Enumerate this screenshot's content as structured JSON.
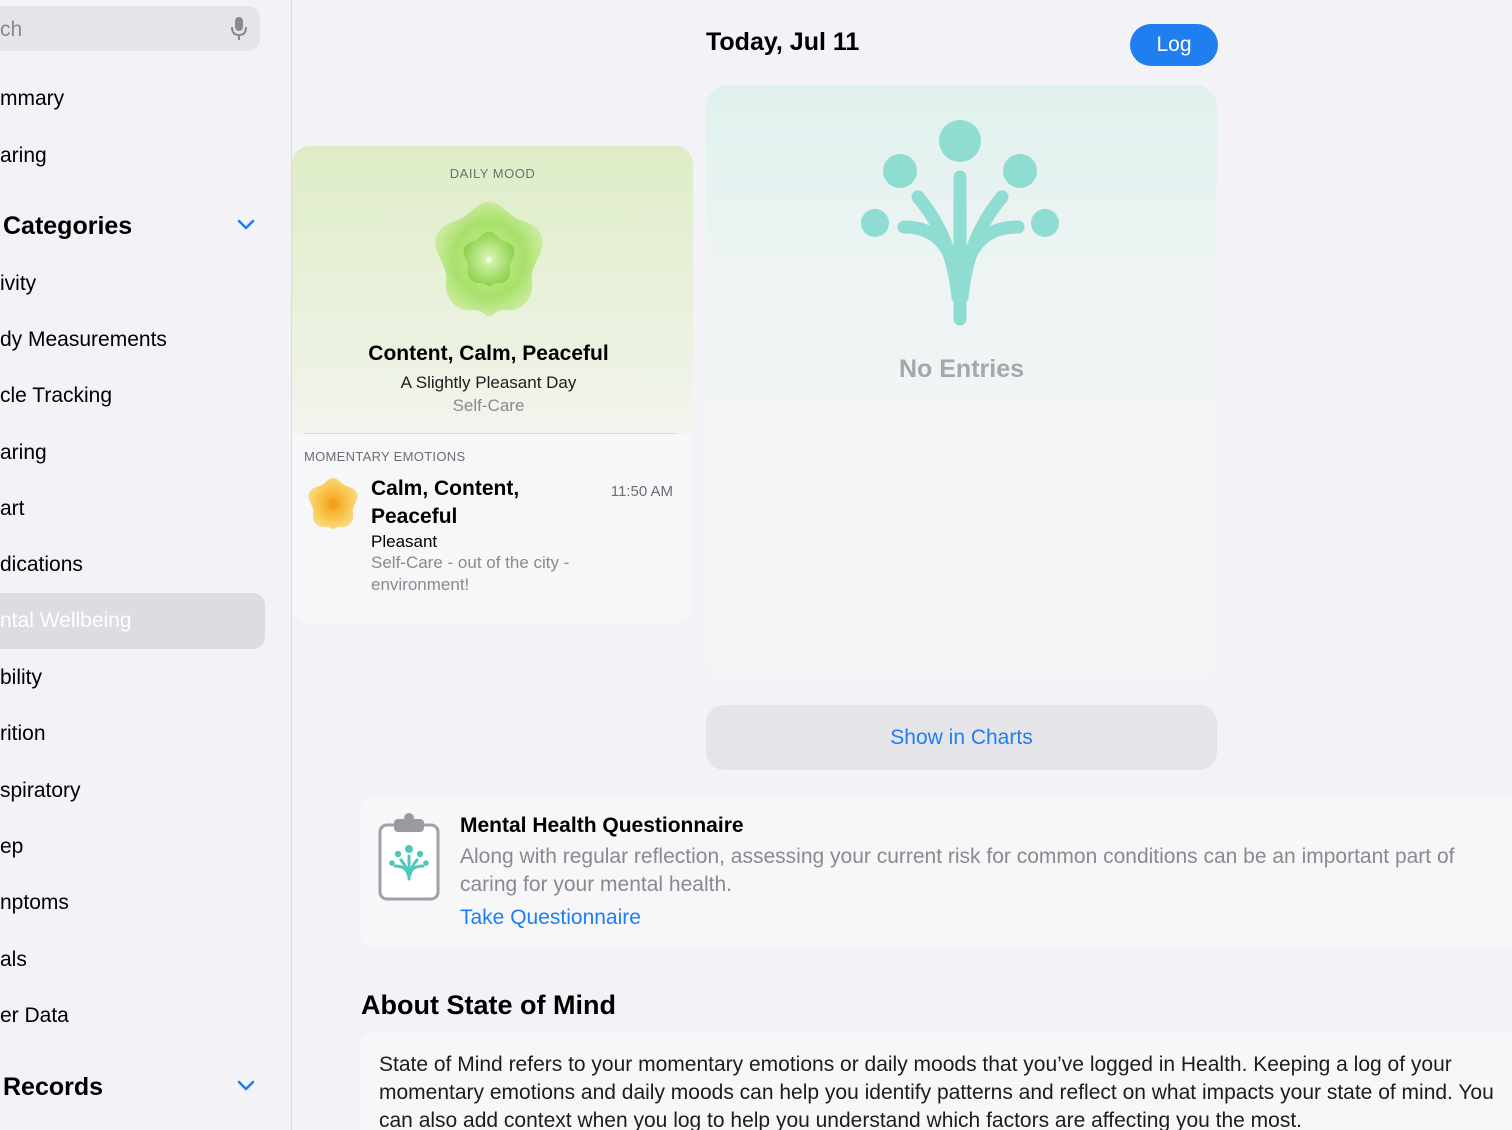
{
  "sidebar": {
    "search_placeholder": "ch",
    "items_top": [
      {
        "label": "mmary"
      },
      {
        "label": "aring"
      }
    ],
    "categories_header": "Categories",
    "categories": [
      {
        "label": "ivity"
      },
      {
        "label": "dy Measurements"
      },
      {
        "label": "cle Tracking"
      },
      {
        "label": "aring"
      },
      {
        "label": "art"
      },
      {
        "label": "dications"
      },
      {
        "label": "ntal Wellbeing",
        "selected": true
      },
      {
        "label": "bility"
      },
      {
        "label": "rition"
      },
      {
        "label": "spiratory"
      },
      {
        "label": "ep"
      },
      {
        "label": "nptoms"
      },
      {
        "label": "als"
      },
      {
        "label": "er Data"
      }
    ],
    "records_header": "Records"
  },
  "header": {
    "date_title": "Today, Jul 11",
    "log_label": "Log"
  },
  "daily_mood": {
    "section_label": "DAILY MOOD",
    "name": "Content, Calm, Peaceful",
    "subtitle": "A Slightly Pleasant Day",
    "context": "Self-Care"
  },
  "momentary": {
    "section_label": "MOMENTARY EMOTIONS",
    "name": "Calm, Content, Peaceful",
    "time": "11:50 AM",
    "valence": "Pleasant",
    "context": "Self-Care - out of the city - environment!"
  },
  "entries": {
    "empty_label": "No Entries"
  },
  "show_in_charts_label": "Show in Charts",
  "questionnaire": {
    "title": "Mental Health Questionnaire",
    "body": "Along with regular reflection, assessing your current risk for common conditions can be an important part of caring for your mental health.",
    "link": "Take Questionnaire"
  },
  "about": {
    "title": "About State of Mind",
    "body": "State of Mind refers to your momentary emotions or daily moods that you’ve logged in Health. Keeping a log of your momentary emotions and daily moods can help you identify patterns and reflect on what impacts your state of mind. You can also add context when you log to help you understand which factors are affecting you the most."
  },
  "colors": {
    "accent": "#1f7ef0",
    "mindfulness_teal": "#8fdcd3",
    "mood_green": "#a8e06a",
    "mood_orange": "#f5b02f"
  },
  "icons": [
    "mic-icon",
    "chevron-down-icon",
    "flower-icon",
    "sprout-icon",
    "clipboard-icon"
  ]
}
